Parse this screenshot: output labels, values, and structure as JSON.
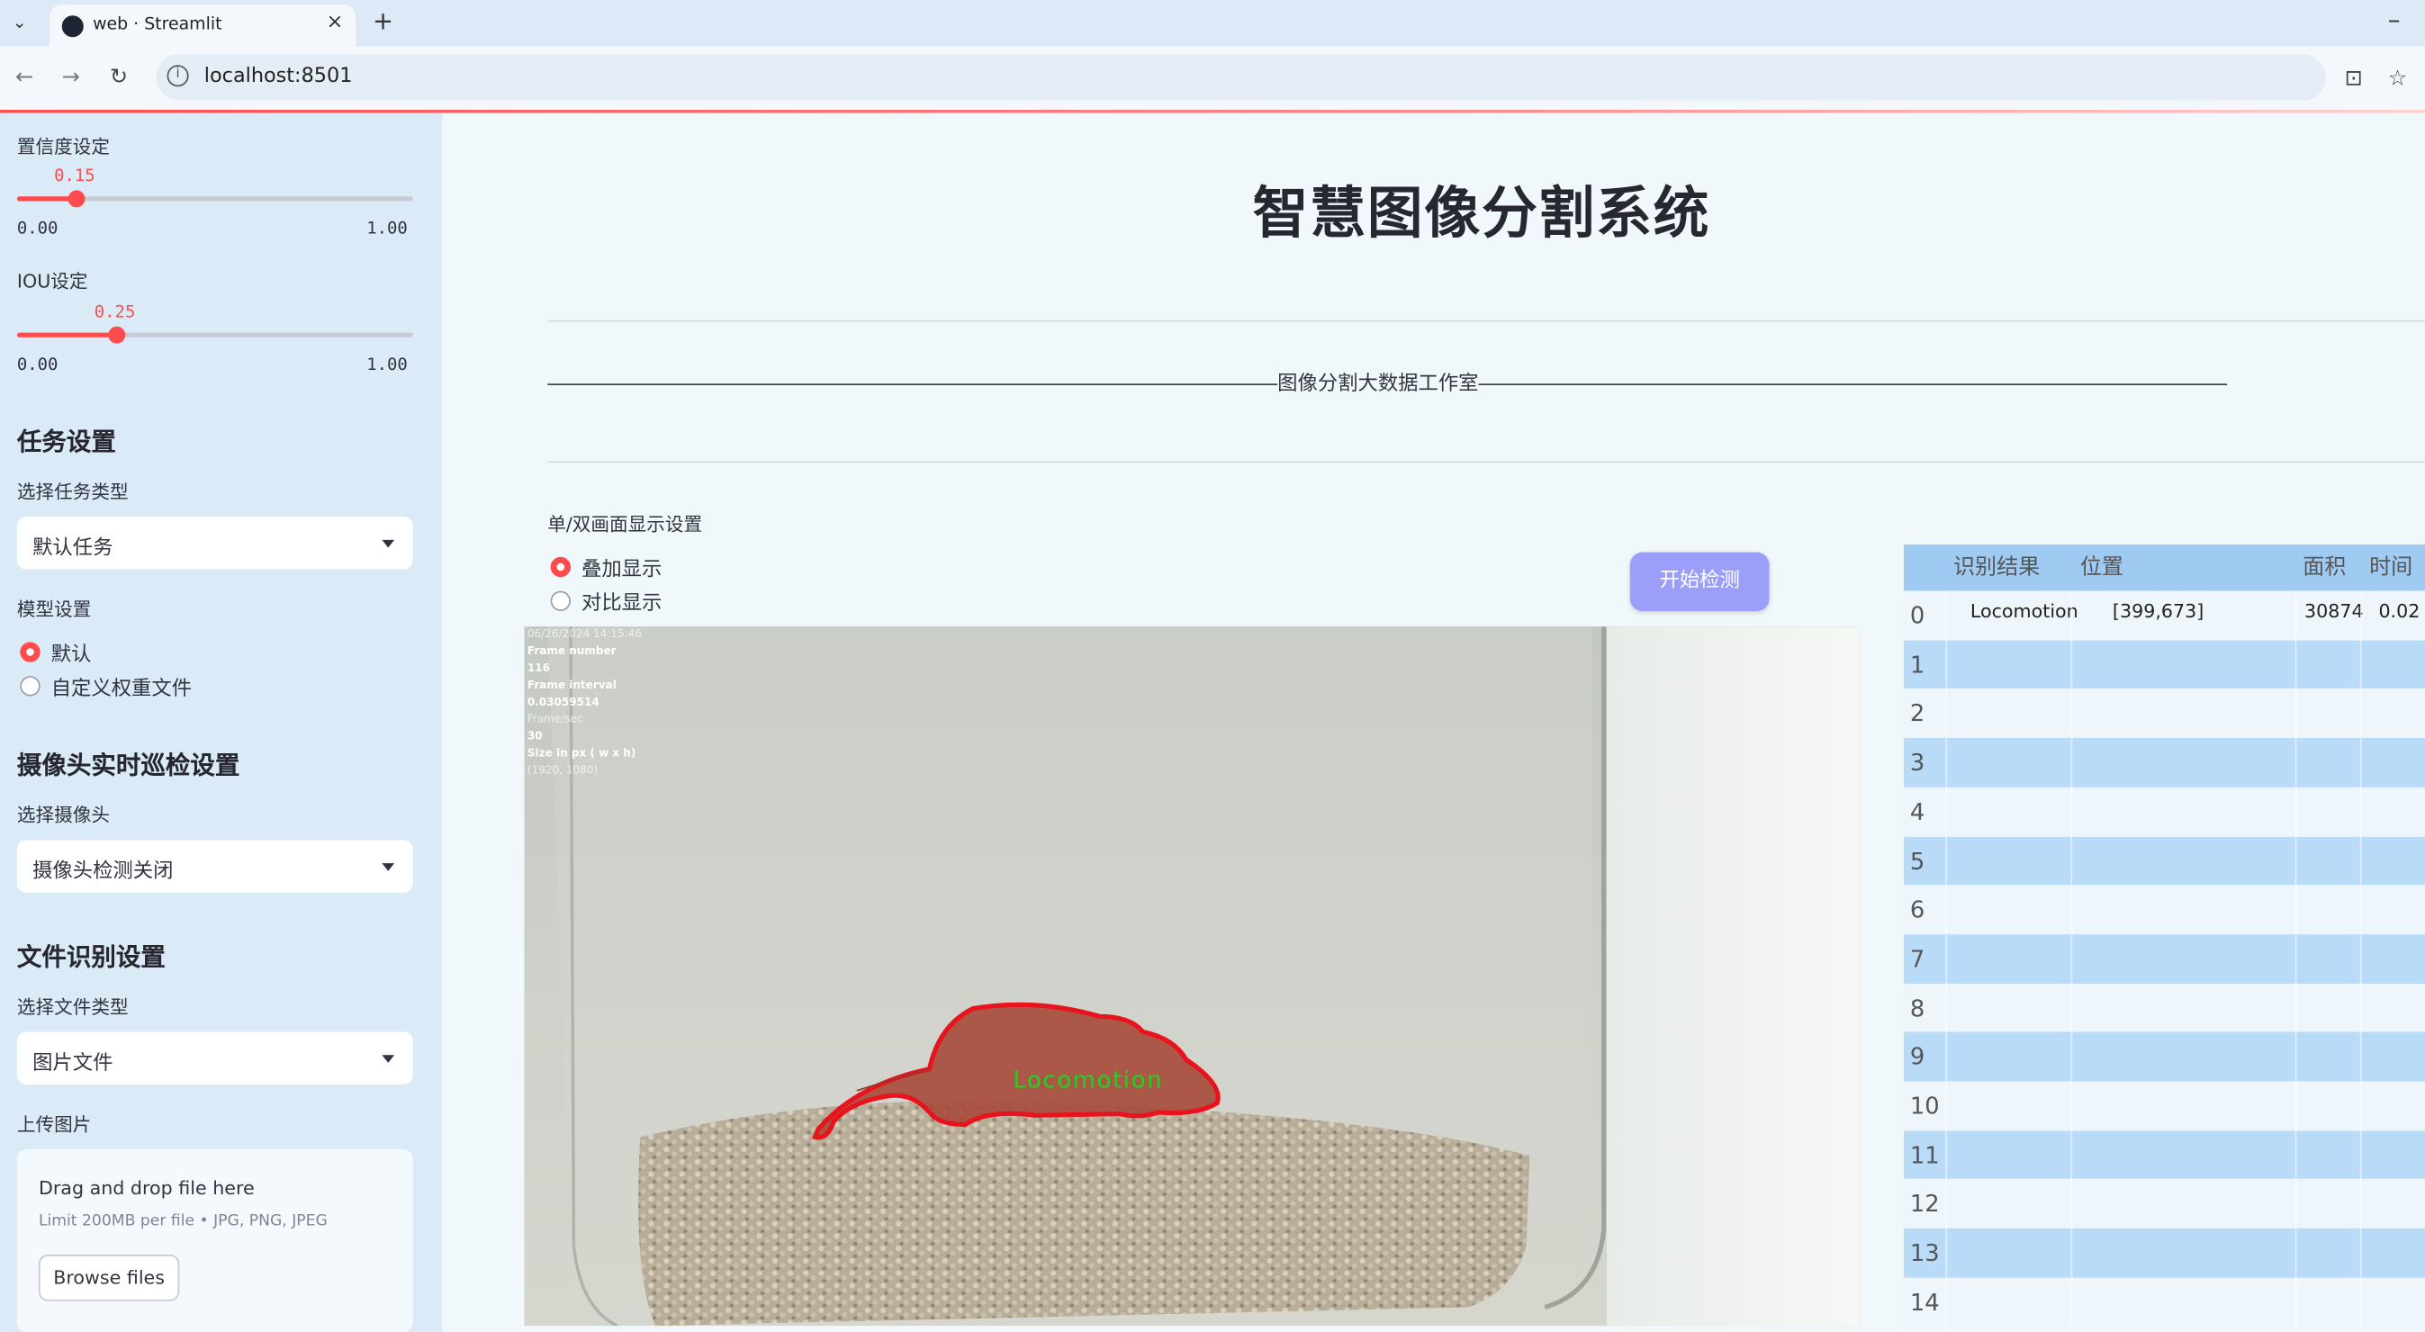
{
  "browser": {
    "tab_title": "web · Streamlit",
    "url": "localhost:8501",
    "tab_close": "×",
    "tab_new": "+",
    "minimize": "–"
  },
  "sidebar": {
    "confidence": {
      "label": "置信度设定",
      "value": "0.15",
      "min": "0.00",
      "max": "1.00",
      "fraction": 0.15
    },
    "iou": {
      "label": "IOU设定",
      "value": "0.25",
      "min": "0.00",
      "max": "1.00",
      "fraction": 0.25
    },
    "task_header": "任务设置",
    "task_type_label": "选择任务类型",
    "task_type_value": "默认任务",
    "model_label": "模型设置",
    "model_options": [
      "默认",
      "自定义权重文件"
    ],
    "model_selected": "默认",
    "camera_header": "摄像头实时巡检设置",
    "camera_label": "选择摄像头",
    "camera_value": "摄像头检测关闭",
    "file_header": "文件识别设置",
    "file_type_label": "选择文件类型",
    "file_type_value": "图片文件",
    "upload_label": "上传图片",
    "upload_title": "Drag and drop file here",
    "upload_limit": "Limit 200MB per file • JPG, PNG, JPEG",
    "upload_button": "Browse files"
  },
  "main": {
    "title": "智慧图像分割系统",
    "banner_text": "图像分割大数据工作室",
    "display_label": "单/双画面显示设置",
    "display_options": [
      "叠加显示",
      "对比显示"
    ],
    "display_selected": "叠加显示",
    "start_button": "开始检测",
    "overlay_lines": [
      "06/26/2024 14:15:46",
      "Frame number",
      "116",
      "Frame interval",
      "0.03059514",
      "Frame/sec",
      "30",
      "Size in px ( w x h)",
      "(1920, 1080)"
    ],
    "detection_label": "Locomotion"
  },
  "table": {
    "headers": [
      "识别结果",
      "位置",
      "面积",
      "时间"
    ],
    "rows": [
      {
        "idx": "0",
        "result": "Locomotion",
        "position": "[399,673]",
        "area": "30874",
        "time": "0.02"
      },
      {
        "idx": "1"
      },
      {
        "idx": "2"
      },
      {
        "idx": "3"
      },
      {
        "idx": "4"
      },
      {
        "idx": "5"
      },
      {
        "idx": "6"
      },
      {
        "idx": "7"
      },
      {
        "idx": "8"
      },
      {
        "idx": "9"
      },
      {
        "idx": "10"
      },
      {
        "idx": "11"
      },
      {
        "idx": "12"
      },
      {
        "idx": "13"
      },
      {
        "idx": "14"
      }
    ]
  },
  "colors": {
    "accent": "#ff4b4b",
    "button": "#9b9ffa",
    "sidebar_bg": "#dbeaf7",
    "table_header": "#9fcbf2"
  }
}
